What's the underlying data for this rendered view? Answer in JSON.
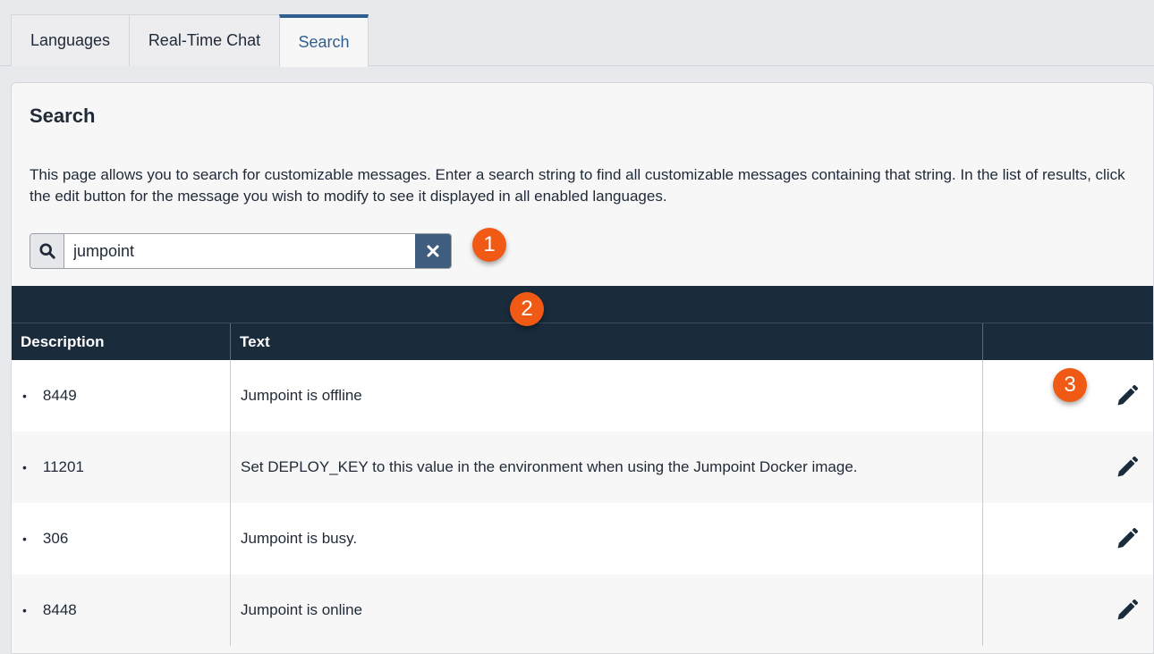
{
  "tabs": [
    {
      "label": "Languages"
    },
    {
      "label": "Real-Time Chat"
    },
    {
      "label": "Search"
    }
  ],
  "panel": {
    "title": "Search",
    "description": "This page allows you to search for customizable messages. Enter a search string to find all customizable messages containing that string. In the list of results, click the edit button for the message you wish to modify to see it displayed in all enabled languages."
  },
  "search": {
    "value": "jumpoint",
    "icon": "search-icon",
    "clear_icon": "close-icon"
  },
  "callouts": [
    "1",
    "2",
    "3"
  ],
  "table": {
    "headers": {
      "description": "Description",
      "text": "Text",
      "actions": ""
    },
    "rows": [
      {
        "id": "8449",
        "text": "Jumpoint is offline"
      },
      {
        "id": "11201",
        "text": "Set DEPLOY_KEY to this value in the environment when using the Jumpoint Docker image."
      },
      {
        "id": "306",
        "text": "Jumpoint is busy."
      },
      {
        "id": "8448",
        "text": "Jumpoint is online"
      }
    ]
  },
  "colors": {
    "accent": "#2f5f8f",
    "table_header": "#1a2b3c",
    "clear_button": "#3f5d7f",
    "callout": "#f05a14"
  }
}
